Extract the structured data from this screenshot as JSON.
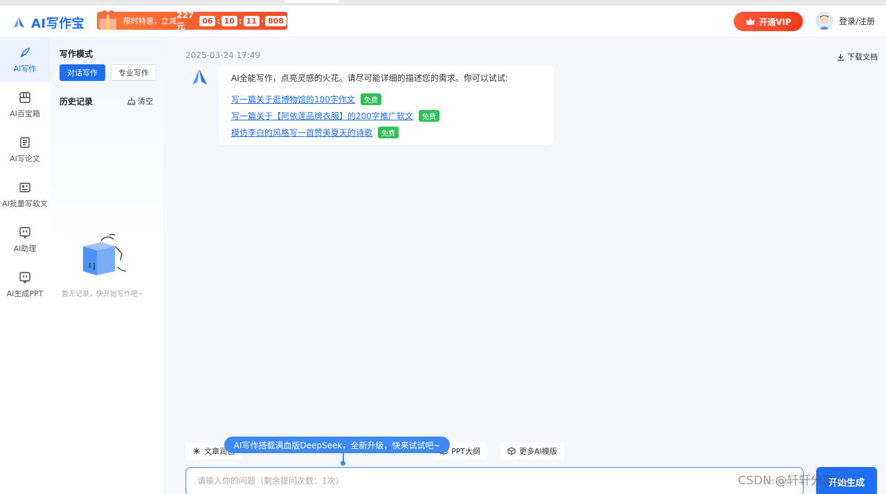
{
  "header": {
    "logo_text": "AI写作宝",
    "promo": {
      "text": "限时特惠，立减",
      "amount": "227元",
      "countdown": [
        "06",
        "10",
        "11",
        "808"
      ]
    },
    "vip_label": "开通VIP",
    "login_label": "登录/注册"
  },
  "nav": {
    "items": [
      {
        "label": "AI写作",
        "icon": "pen-icon",
        "active": true
      },
      {
        "label": "AI百宝箱",
        "icon": "toolbox-icon",
        "active": false
      },
      {
        "label": "AI写论文",
        "icon": "document-icon",
        "active": false
      },
      {
        "label": "AI批量写软文",
        "icon": "id-card-icon",
        "active": false
      },
      {
        "label": "AI助理",
        "icon": "assistant-icon",
        "active": false
      },
      {
        "label": "AI生成PPT",
        "icon": "ppt-icon",
        "active": false
      }
    ]
  },
  "panel": {
    "mode_title": "写作模式",
    "modes": [
      {
        "label": "对话写作",
        "active": true
      },
      {
        "label": "专业写作",
        "active": false
      }
    ],
    "history_title": "历史记录",
    "clear_label": "清空",
    "empty_text": "暂无记录，快开始写作吧~"
  },
  "main": {
    "timestamp": "2025-03-24 17:49",
    "download_label": "下载文档",
    "intro": "AI全能写作，点亮灵感的火花。请尽可能详细的描述您的需求。你可以试试:",
    "suggestions": [
      {
        "text": "写一篇关于逛博物馆的100字作文",
        "badge": "免费"
      },
      {
        "text": "写一篇关于【阿依莲品牌衣服】的200字推广软文",
        "badge": "免费"
      },
      {
        "text": "模仿李白的风格写一首赞美夏天的诗歌",
        "badge": "免费"
      }
    ],
    "tools": [
      {
        "label": "文章润色",
        "icon": "sparkle-icon"
      },
      {
        "label": "PPT大纲",
        "icon": "ppt-outline-icon"
      },
      {
        "label": "更多AI模版",
        "icon": "cube-icon"
      }
    ],
    "tooltip": "AI写作搭载满血版DeepSeek，全新升级，快来试试吧~",
    "input_placeholder": "请输入你的问题（剩余提问次数：1次）",
    "char_count": "0/1000",
    "generate_label": "开始生成"
  },
  "watermark": "CSDN @轩轩分享AI",
  "colors": {
    "primary": "#1e6ff1",
    "vip": "#f23a1e",
    "free_badge": "#2fc25b"
  }
}
